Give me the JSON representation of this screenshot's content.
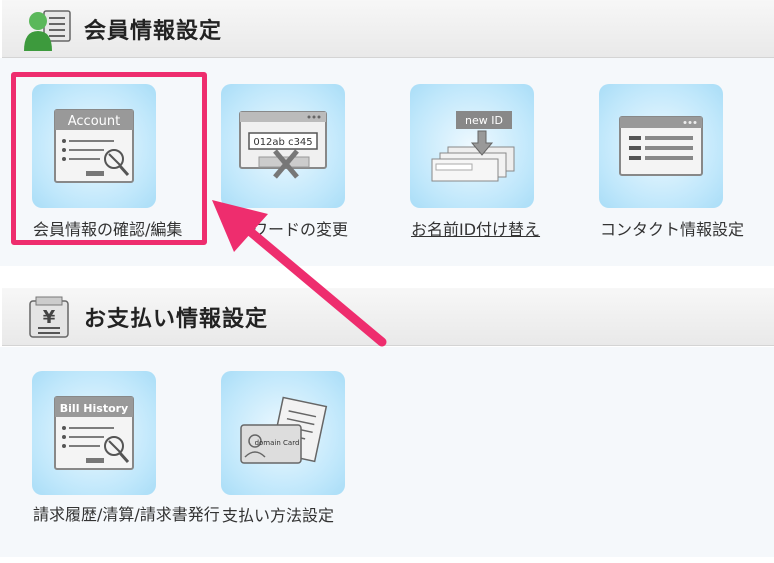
{
  "member_section": {
    "title": "会員情報設定",
    "tiles": [
      {
        "label": "会員情報の確認/編集",
        "icon_text": "Account",
        "icon": "account-card-icon"
      },
      {
        "label": "ワードの変更",
        "icon_text": "012ab c345",
        "icon": "password-change-icon"
      },
      {
        "label": "お名前ID付け替え",
        "icon_text": "new ID",
        "icon": "id-transfer-icon"
      },
      {
        "label": "コンタクト情報設定",
        "icon": "contact-window-icon"
      }
    ]
  },
  "payment_section": {
    "title": "お支払い情報設定",
    "tiles": [
      {
        "label": "請求履歴/清算/請求書発行",
        "icon_text": "Bill History",
        "icon": "bill-history-icon"
      },
      {
        "label": "支払い方法設定",
        "icon_text": "domain Card",
        "icon": "payment-card-icon"
      }
    ]
  },
  "colors": {
    "highlight": "#ee2d6e",
    "tile_bg": "#bfe7fb"
  }
}
